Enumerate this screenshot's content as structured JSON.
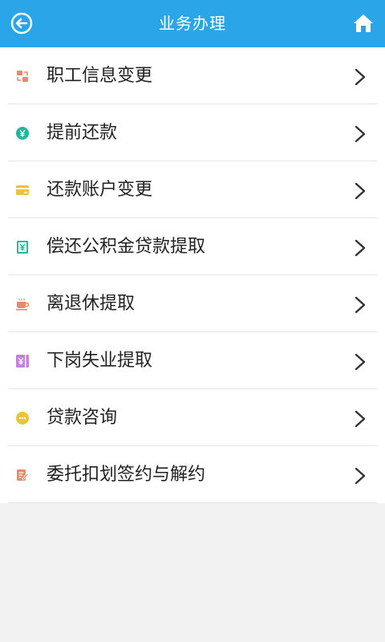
{
  "header": {
    "title": "业务办理",
    "back_icon": "back-circle-arrow-icon",
    "home_icon": "home-icon",
    "bg_color": "#2aa6e8"
  },
  "menu": {
    "items": [
      {
        "label": "职工信息变更",
        "icon": "exchange-icon",
        "color": "#e8896a"
      },
      {
        "label": "提前还款",
        "icon": "yen-coin-icon",
        "color": "#1fb89a"
      },
      {
        "label": "还款账户变更",
        "icon": "card-icon",
        "color": "#e9c43c"
      },
      {
        "label": "偿还公积金贷款提取",
        "icon": "yen-receipt-icon",
        "color": "#1fb89a"
      },
      {
        "label": "离退休提取",
        "icon": "teacup-icon",
        "color": "#e8896a"
      },
      {
        "label": "下岗失业提取",
        "icon": "yen-slip-icon",
        "color": "#c57de8"
      },
      {
        "label": "贷款咨询",
        "icon": "chat-bubble-icon",
        "color": "#e9c43c"
      },
      {
        "label": "委托扣划签约与解约",
        "icon": "edit-document-icon",
        "color": "#e8896a"
      }
    ],
    "chevron_icon": "chevron-right-icon"
  }
}
